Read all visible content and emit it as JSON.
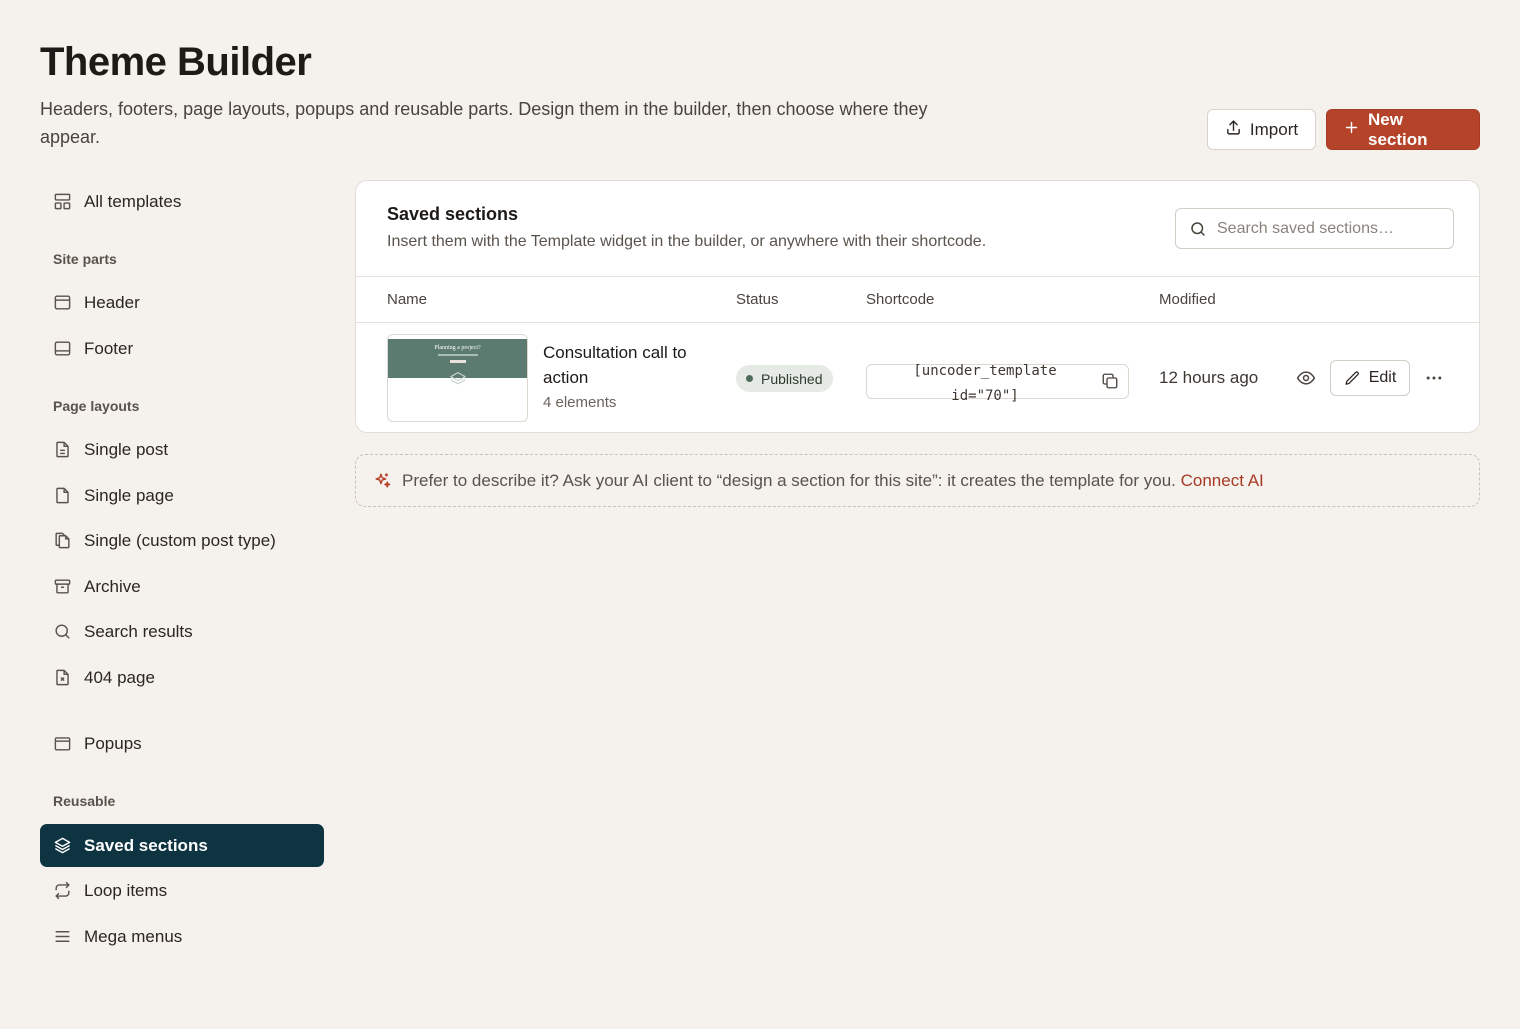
{
  "page": {
    "title": "Theme Builder",
    "subtitle": "Headers, footers, page layouts, popups and reusable parts. Design them in the builder, then choose where they appear."
  },
  "header_actions": {
    "import_label": "Import",
    "new_section_label": "New section",
    "accent_color": "#b5432a"
  },
  "sidebar": {
    "all_templates": "All templates",
    "groups": {
      "site_parts": "Site parts",
      "page_layouts": "Page layouts",
      "reusable": "Reusable"
    },
    "items": {
      "header": "Header",
      "footer": "Footer",
      "single_post": "Single post",
      "single_page": "Single page",
      "single_cpt": "Single (custom post type)",
      "archive": "Archive",
      "search_results": "Search results",
      "page_404": "404 page",
      "popups": "Popups",
      "saved_sections": "Saved sections",
      "loop_items": "Loop items",
      "mega_menus": "Mega menus"
    },
    "active_item": "Saved sections",
    "active_color": "#0e3442"
  },
  "panel": {
    "title": "Saved sections",
    "description": "Insert them with the Template widget in the builder, or anywhere with their shortcode.",
    "search_placeholder": "Search saved sections…",
    "columns": {
      "name": "Name",
      "status": "Status",
      "shortcode": "Shortcode",
      "modified": "Modified"
    },
    "rows": [
      {
        "name": "Consultation call to action",
        "elements": "4 elements",
        "thumbnail_title": "Planning a project?",
        "status": "Published",
        "shortcode": "[uncoder_template id=\"70\"]",
        "modified": "12 hours ago",
        "edit_label": "Edit"
      }
    ]
  },
  "ai_hint": {
    "text": "Prefer to describe it? Ask your AI client to “design a section for this site”: it creates the template for you.",
    "link": "Connect AI"
  }
}
